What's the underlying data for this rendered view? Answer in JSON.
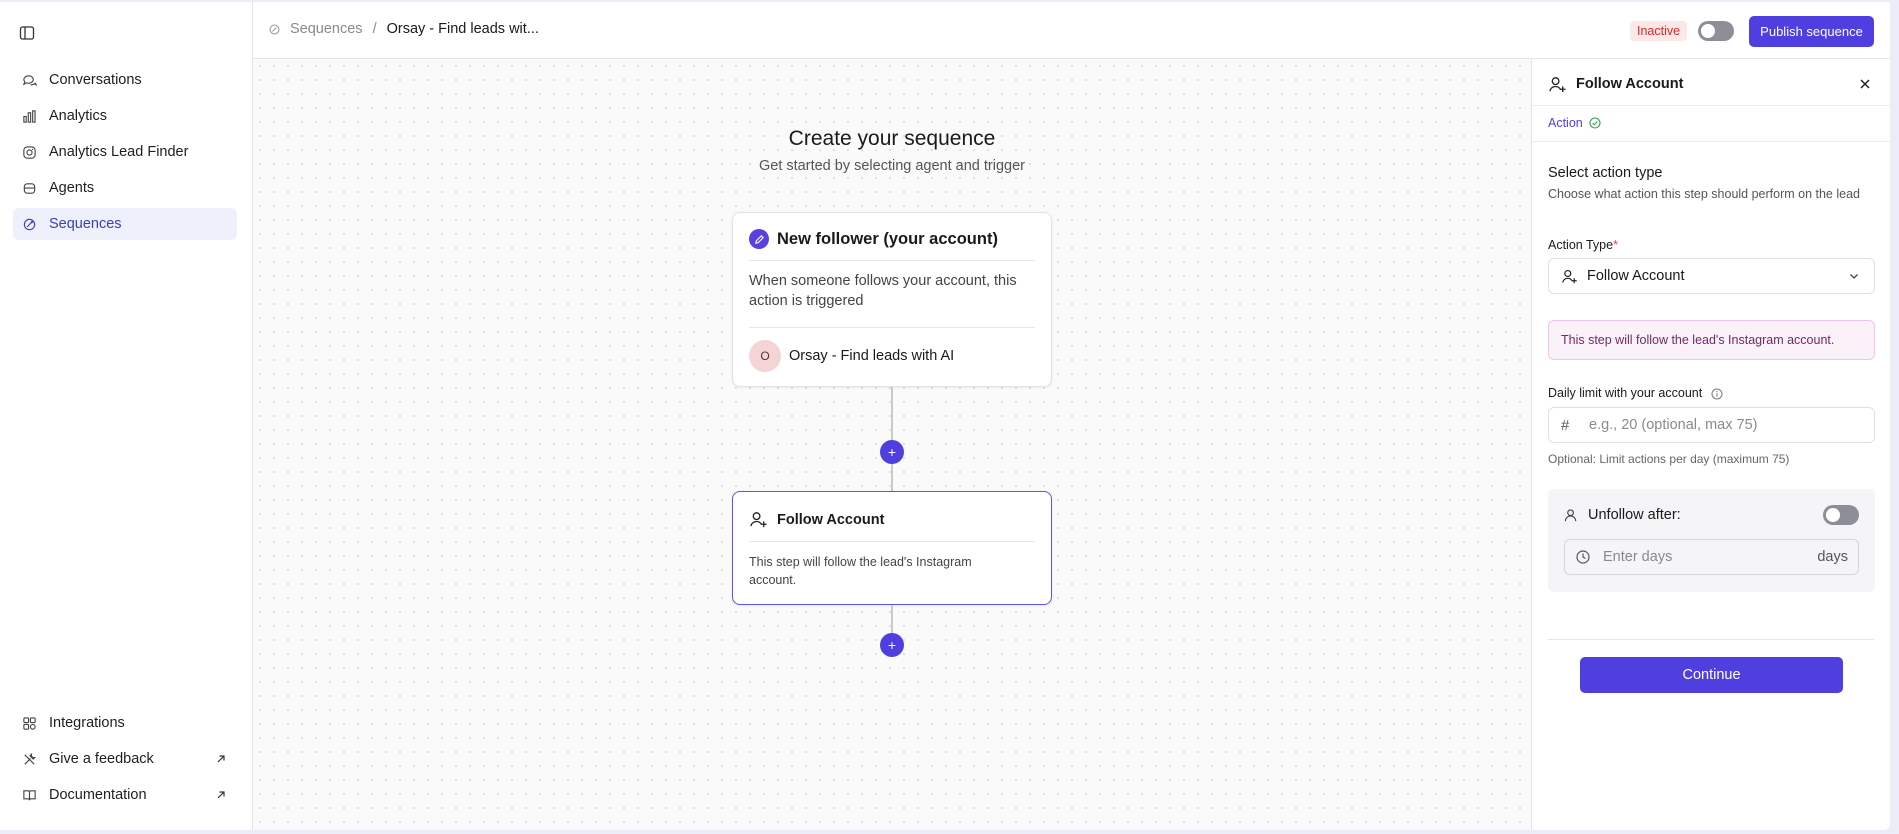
{
  "sidebar": {
    "toggle_icon": "sidebar-panel-icon",
    "items": [
      {
        "label": "Conversations",
        "icon": "chat-bubbles-icon"
      },
      {
        "label": "Analytics",
        "icon": "bar-chart-icon"
      },
      {
        "label": "Analytics Lead Finder",
        "icon": "instagram-icon"
      },
      {
        "label": "Agents",
        "icon": "bot-icon"
      },
      {
        "label": "Sequences",
        "icon": "sequence-icon",
        "active": true
      }
    ],
    "bottom_items": [
      {
        "label": "Integrations",
        "icon": "grid-icon"
      },
      {
        "label": "Give a feedback",
        "icon": "tools-icon",
        "external": true
      },
      {
        "label": "Documentation",
        "icon": "book-icon",
        "external": true
      }
    ]
  },
  "header": {
    "breadcrumb_root": "Sequences",
    "breadcrumb_separator": "/",
    "breadcrumb_current": "Orsay - Find leads wit...",
    "status": "Inactive",
    "publish_label": "Publish sequence"
  },
  "canvas": {
    "title": "Create your sequence",
    "subtitle": "Get started by selecting agent and trigger",
    "trigger": {
      "title": "New follower (your account)",
      "description": "When someone follows your account, this action is triggered",
      "agent_initial": "O",
      "agent_name": "Orsay - Find leads with AI"
    },
    "add_step_symbol": "+",
    "action": {
      "title": "Follow Account",
      "description": "This step will follow the lead's Instagram account."
    }
  },
  "panel": {
    "title": "Follow Account",
    "tab": "Action",
    "section_title": "Select action type",
    "section_subtitle": "Choose what action this step should perform on the lead",
    "action_type_label": "Action Type",
    "required_mark": "*",
    "action_type_value": "Follow Account",
    "info_text": "This step will follow the lead's Instagram account.",
    "daily_limit_label": "Daily limit with your account",
    "daily_limit_prefix": "#",
    "daily_limit_placeholder": "e.g., 20 (optional, max 75)",
    "daily_limit_help": "Optional: Limit actions per day (maximum 75)",
    "unfollow_label": "Unfollow after:",
    "days_placeholder": "Enter days",
    "days_suffix": "days",
    "continue_label": "Continue"
  },
  "colors": {
    "accent": "#4f3fe0",
    "inactive_badge_bg": "#fde7e7",
    "inactive_badge_text": "#d12b2b",
    "info_bg": "#fbf1f9"
  }
}
